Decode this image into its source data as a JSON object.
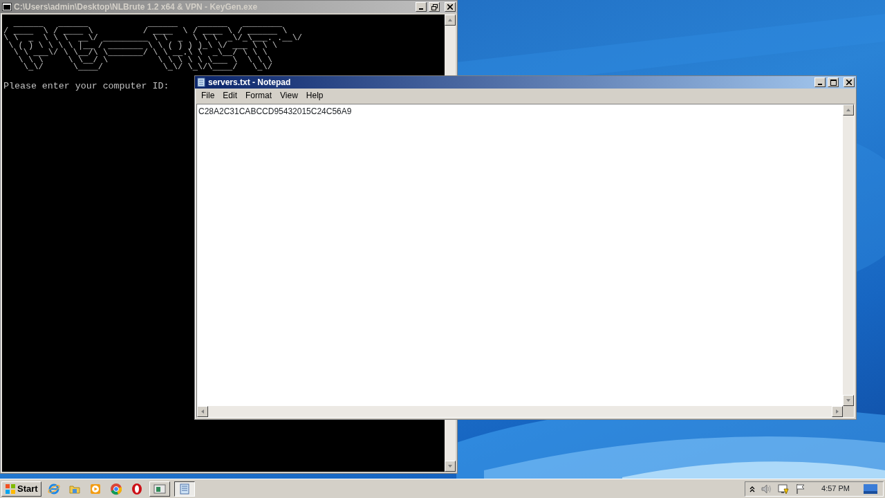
{
  "console_window": {
    "title": "C:\\Users\\admin\\Desktop\\NLBrute 1.2 x64 & VPN - KeyGen.exe",
    "active": false,
    "ascii_art": [
      "  ______   ______            ______    ______   ________",
      "/ ____  \\ / ____ \\          / ____  \\ / ____ \\ / ______ \\",
      "\\ \\  _  \\ \\ \\  __\\/ _________ \\ \\  _  \\ \\ \\  _\\/_\\___. .__\\/",
      " \\ ( ) \\ \\ \\ \\ |__ / _______ \\ \\ ( ) ) )_\\ \\/ ___ \\ \\ \\",
      "  \\ \\ ___\\/ \\ \\__/\\ \\_______/ \\ \\ __.\\ \\  _\\__/ \\ \\ \\",
      "   \\ \\ \\     \\ \\__/ \\          \\ \\ \\ \\ \\ \\___ \\  \\ \\ \\",
      "    \\_\\/      \\____/            \\_\\/ \\_\\/\\____/   \\_\\/"
    ],
    "prompt": "Please enter your computer ID:"
  },
  "notepad_window": {
    "title": "servers.txt - Notepad",
    "active": true,
    "menu": [
      {
        "label": "File"
      },
      {
        "label": "Edit"
      },
      {
        "label": "Format"
      },
      {
        "label": "View"
      },
      {
        "label": "Help"
      }
    ],
    "content": "C28A2C31CABCCD95432015C24C56A9"
  },
  "taskbar": {
    "start_label": "Start",
    "items": [
      {
        "kind": "browser"
      },
      {
        "kind": "folder"
      },
      {
        "kind": "media"
      },
      {
        "kind": "chrome"
      },
      {
        "kind": "opera"
      },
      {
        "kind": "console",
        "selected": false
      },
      {
        "kind": "notepad",
        "selected": true
      }
    ],
    "clock": "4:57 PM"
  }
}
